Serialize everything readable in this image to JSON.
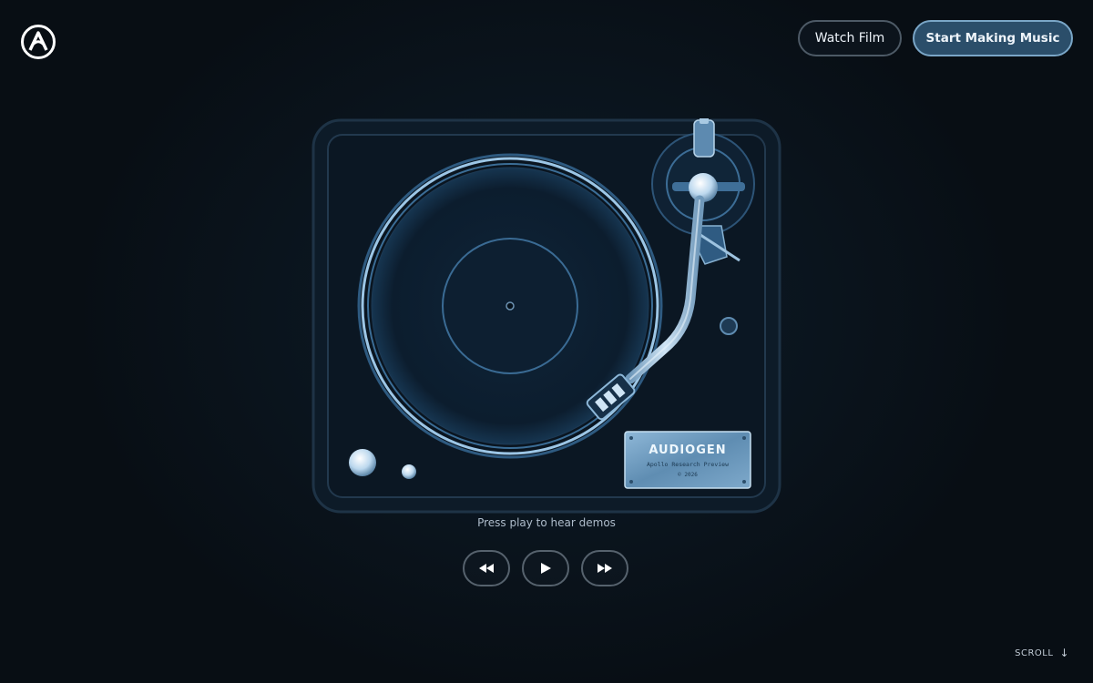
{
  "header": {
    "logo_icon": "audiogen-a-logo-icon",
    "watch_film_label": "Watch Film",
    "start_making_music_label": "Start Making Music"
  },
  "turntable": {
    "plate": {
      "brand": "AUDIOGEN",
      "subtitle": "Apollo Research Preview",
      "year": "© 2026"
    }
  },
  "player": {
    "caption": "Press play to hear demos",
    "controls": [
      {
        "name": "rewind-button",
        "icon": "rewind-icon"
      },
      {
        "name": "play-button",
        "icon": "play-icon"
      },
      {
        "name": "fast-forward-button",
        "icon": "fast-forward-icon"
      }
    ]
  },
  "scroll": {
    "label": "SCROLL",
    "arrow": "↓"
  },
  "colors": {
    "background": "#0b1620",
    "accent": "#7aa6c7",
    "primary_button": "#2b4e6a"
  }
}
